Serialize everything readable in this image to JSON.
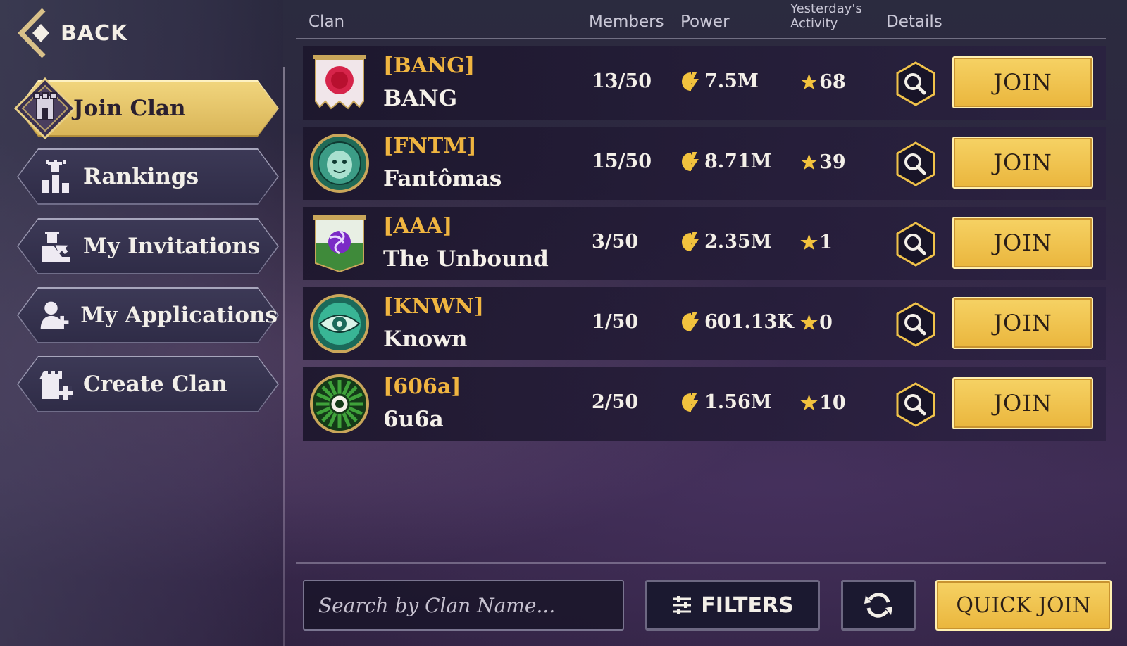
{
  "back": {
    "label": "BACK"
  },
  "menu": {
    "items": [
      {
        "label": "Join Clan",
        "icon": "tower-shield-icon",
        "active": true
      },
      {
        "label": "Rankings",
        "icon": "rankings-icon",
        "active": false
      },
      {
        "label": "My Invitations",
        "icon": "invitation-icon",
        "active": false
      },
      {
        "label": "My Applications",
        "icon": "add-user-icon",
        "active": false
      },
      {
        "label": "Create Clan",
        "icon": "create-clan-icon",
        "active": false
      }
    ]
  },
  "table": {
    "headers": {
      "clan": "Clan",
      "members": "Members",
      "power": "Power",
      "activity_line1": "Yesterday's",
      "activity_line2": "Activity",
      "details": "Details"
    },
    "join_label": "JOIN",
    "rows": [
      {
        "tag": "[BANG]",
        "name": "BANG",
        "members": "13/50",
        "power": "7.5M",
        "activity": "68",
        "emblem": "red-sun-banner-icon"
      },
      {
        "tag": "[FNTM]",
        "name": "Fantômas",
        "members": "15/50",
        "power": "8.71M",
        "activity": "39",
        "emblem": "green-mask-emblem-icon"
      },
      {
        "tag": "[AAA]",
        "name": "The Unbound",
        "members": "3/50",
        "power": "2.35M",
        "activity": "1",
        "emblem": "purple-triskelion-banner-icon"
      },
      {
        "tag": "[KNWN]",
        "name": "Known",
        "members": "1/50",
        "power": "601.13K",
        "activity": "0",
        "emblem": "eye-emblem-icon"
      },
      {
        "tag": "[606a]",
        "name": "6u6a",
        "members": "2/50",
        "power": "1.56M",
        "activity": "10",
        "emblem": "green-burst-emblem-icon"
      }
    ]
  },
  "search": {
    "placeholder": "Search by Clan Name..."
  },
  "filters": {
    "label": "FILTERS"
  },
  "quick_join": {
    "label": "QUICK JOIN"
  },
  "colors": {
    "gold": "#eab63d",
    "tag_orange": "#f0b540",
    "panel_dark": "#1b1930"
  }
}
